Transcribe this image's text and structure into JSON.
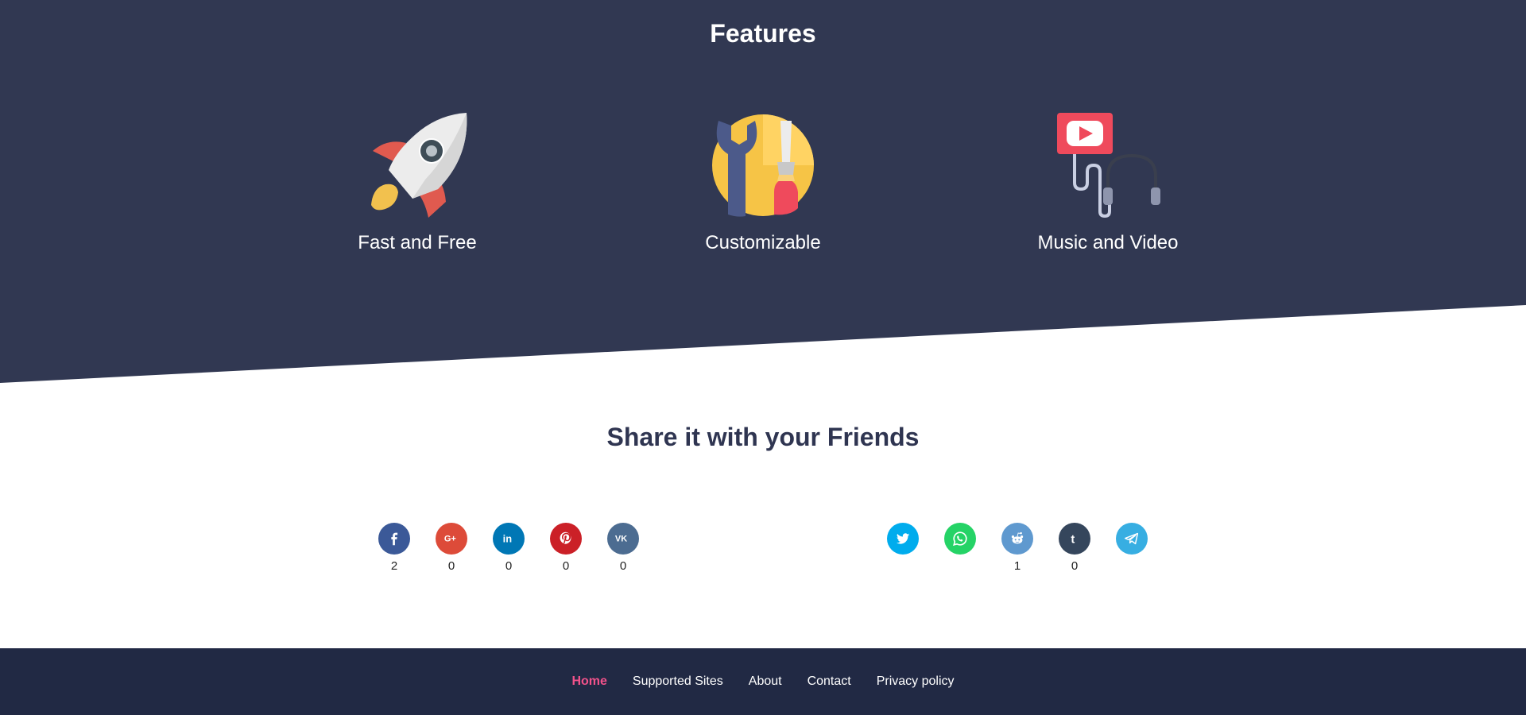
{
  "features": {
    "title": "Features",
    "items": [
      {
        "label": "Fast and Free",
        "icon": "rocket-icon"
      },
      {
        "label": "Customizable",
        "icon": "tools-icon"
      },
      {
        "label": "Music and Video",
        "icon": "media-headphones-icon"
      }
    ],
    "colors": {
      "background": "#313852"
    }
  },
  "share": {
    "title": "Share it with your Friends",
    "buttons": [
      {
        "network": "Facebook",
        "icon": "facebook-icon",
        "color": "#3b5998",
        "count": "2"
      },
      {
        "network": "Google+",
        "icon": "google-plus-icon",
        "color": "#dd4b39",
        "count": "0"
      },
      {
        "network": "LinkedIn",
        "icon": "linkedin-icon",
        "color": "#0077b5",
        "count": "0"
      },
      {
        "network": "Pinterest",
        "icon": "pinterest-icon",
        "color": "#cb2027",
        "count": "0"
      },
      {
        "network": "VK",
        "icon": "vk-icon",
        "color": "#4c6c91",
        "count": "0"
      },
      {
        "network": "Twitter",
        "icon": "twitter-icon",
        "color": "#00aced",
        "count": ""
      },
      {
        "network": "WhatsApp",
        "icon": "whatsapp-icon",
        "color": "#25d366",
        "count": ""
      },
      {
        "network": "Reddit",
        "icon": "reddit-icon",
        "color": "#5f99cf",
        "count": "1"
      },
      {
        "network": "Tumblr",
        "icon": "tumblr-icon",
        "color": "#35465c",
        "count": "0"
      },
      {
        "network": "Telegram",
        "icon": "telegram-icon",
        "color": "#37aee2",
        "count": ""
      }
    ]
  },
  "footer": {
    "links": [
      {
        "label": "Home",
        "active": true
      },
      {
        "label": "Supported Sites",
        "active": false
      },
      {
        "label": "About",
        "active": false
      },
      {
        "label": "Contact",
        "active": false
      },
      {
        "label": "Privacy policy",
        "active": false
      }
    ],
    "colors": {
      "background": "#212944",
      "active": "#f2528b"
    }
  }
}
